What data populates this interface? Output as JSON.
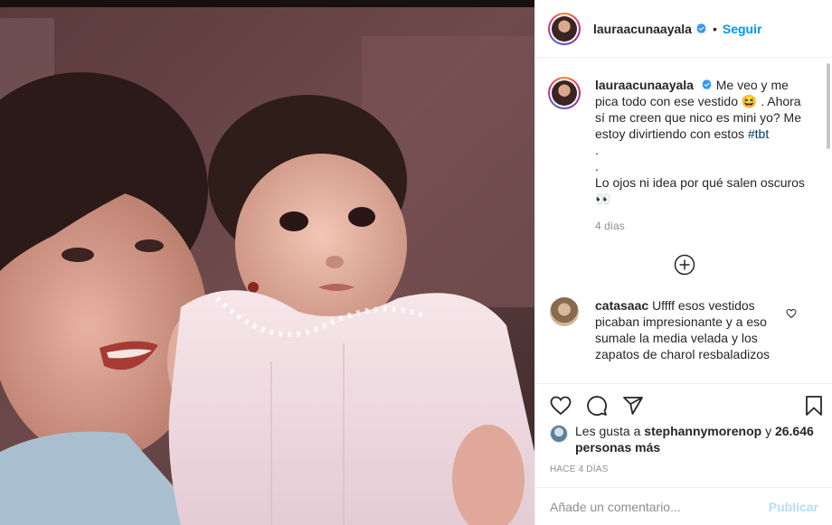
{
  "post": {
    "photo_icon": "vintage-photo-mother-and-baby",
    "author": "lauraacunaayala",
    "follow_label": "Seguir",
    "dot": "•",
    "caption": {
      "username": "lauraacunaayala",
      "text_part1": "Me veo y me pica todo con ese vestido ",
      "emoji_laugh": "😆",
      "text_part2": " . Ahora sí me creen que nico es mini yo? Me estoy divirtiendo con estos ",
      "hashtag": "#tbt",
      "line_dot1": ".",
      "line_dot2": ".",
      "text_part3": "Lo ojos ni idea por qué salen oscuros",
      "emoji_eyes": "👀",
      "time": "4 días"
    },
    "comments": [
      {
        "username": "catasaac",
        "text": "Uffff esos vestidos picaban impresionante y a eso sumale la media velada y los zapatos de charol resbaladizos"
      }
    ],
    "likes": {
      "prefix": "Les gusta a",
      "liker": "stephannymorenop",
      "conj": "y",
      "count": "26.646 personas más"
    },
    "timestamp": "HACE 4 DÍAS",
    "add_comment_placeholder": "Añade un comentario...",
    "publish_label": "Publicar"
  },
  "colors": {
    "link_blue": "#0095f6",
    "publish_disabled": "#b2dffc",
    "secondary_text": "#8e8e8e",
    "verified_blue": "#3897f0"
  }
}
